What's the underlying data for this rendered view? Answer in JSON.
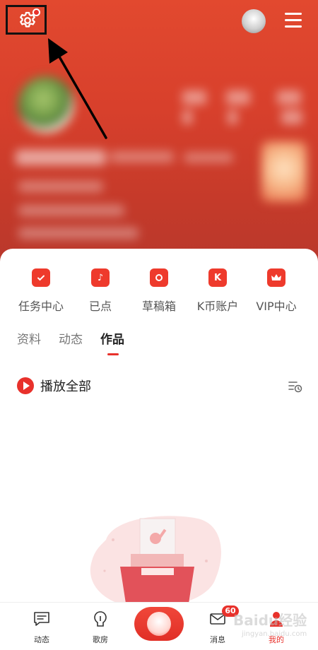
{
  "header": {
    "has_settings_notification": true,
    "icons": [
      "gear-icon",
      "avatar",
      "menu-icon"
    ]
  },
  "quick_actions": [
    {
      "label": "任务中心",
      "icon": "calendar-check-icon"
    },
    {
      "label": "已点",
      "icon": "music-note-icon"
    },
    {
      "label": "草稿箱",
      "icon": "draft-icon"
    },
    {
      "label": "K币账户",
      "icon": "k-coin-icon"
    },
    {
      "label": "VIP中心",
      "icon": "crown-icon"
    }
  ],
  "tabs": [
    {
      "label": "资料",
      "active": false
    },
    {
      "label": "动态",
      "active": false
    },
    {
      "label": "作品",
      "active": true
    }
  ],
  "play_all": {
    "label": "播放全部"
  },
  "bottom_nav": [
    {
      "label": "动态",
      "icon": "message-icon"
    },
    {
      "label": "歌房",
      "icon": "mic-room-icon"
    },
    {
      "label": "",
      "icon": "record-center-icon"
    },
    {
      "label": "消息",
      "icon": "mail-icon",
      "badge": "60"
    },
    {
      "label": "我的",
      "icon": "user-icon",
      "active": true
    }
  ],
  "watermark": {
    "text": "Baidu经验",
    "sub": "jingyan.baidu.com"
  },
  "colors": {
    "accent": "#e8312b",
    "header": "#d8402c"
  }
}
